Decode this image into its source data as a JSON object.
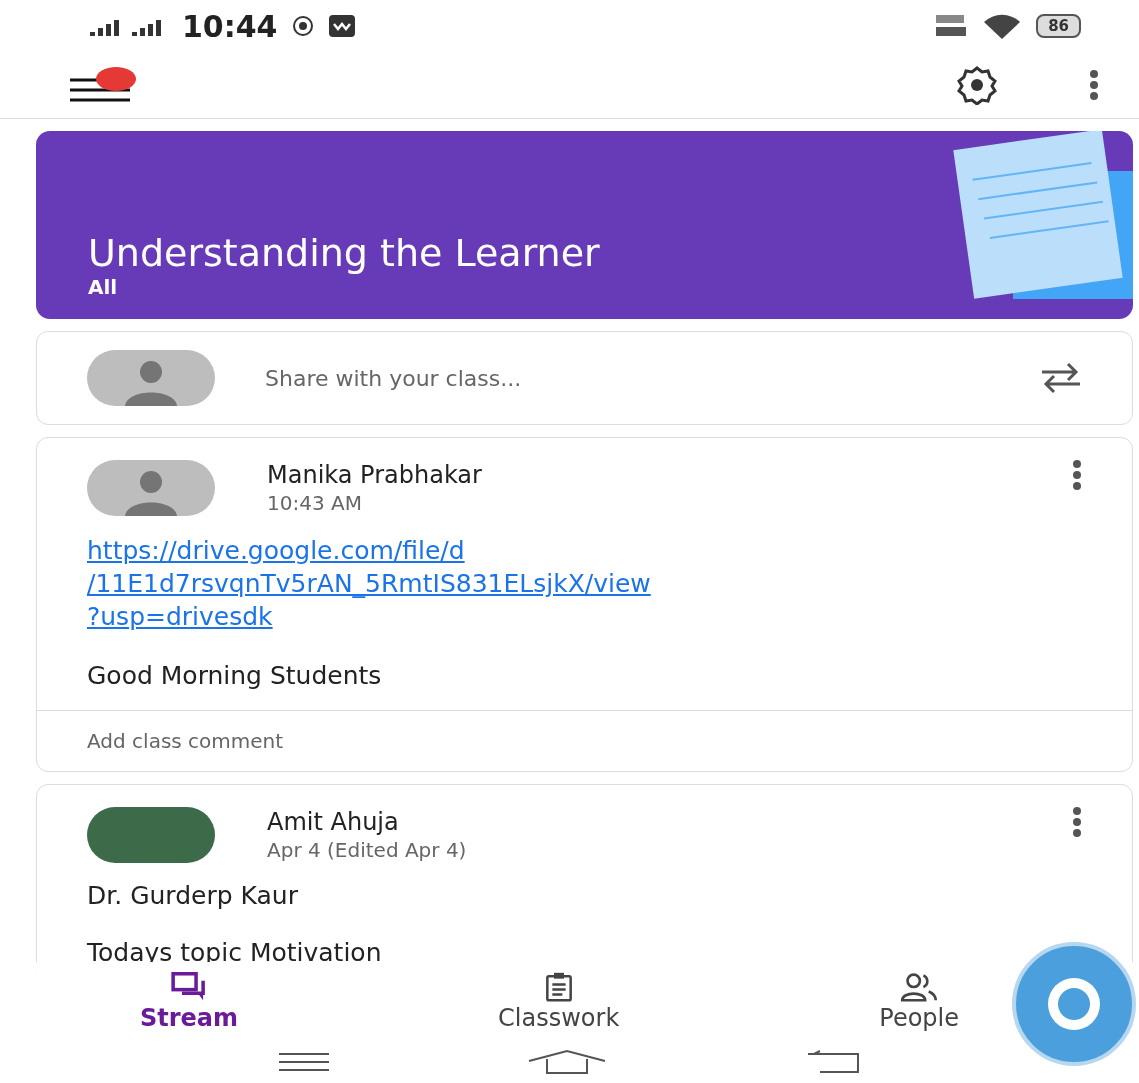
{
  "status_bar": {
    "time": "10:44",
    "battery": "86"
  },
  "app_bar": {
    "notification_dot": true
  },
  "banner": {
    "title": "Understanding the Learner",
    "subtitle": "All"
  },
  "share": {
    "placeholder": "Share with your class..."
  },
  "posts": [
    {
      "author": "Manika Prabhakar",
      "time": "10:43 AM",
      "kind": "silhouette",
      "link_lines": [
        "https://drive.google.com/file/d",
        "/11E1d7rsvqnTv5rAN_5RmtIS831ELsjkX/view",
        "?usp=drivesdk"
      ],
      "body": [
        "Good Morning Students"
      ],
      "comment_placeholder": "Add class comment"
    },
    {
      "author": "Amit Ahuja",
      "time": "Apr 4 (Edited Apr 4)",
      "kind": "photo",
      "body": [
        "Dr. Gurderp Kaur",
        "Todays topic Motivation"
      ]
    }
  ],
  "nav": [
    {
      "label": "Stream",
      "kind": "stream",
      "selected": true
    },
    {
      "label": "Classwork",
      "kind": "classwork",
      "selected": false
    },
    {
      "label": "People",
      "kind": "people",
      "selected": false
    }
  ]
}
